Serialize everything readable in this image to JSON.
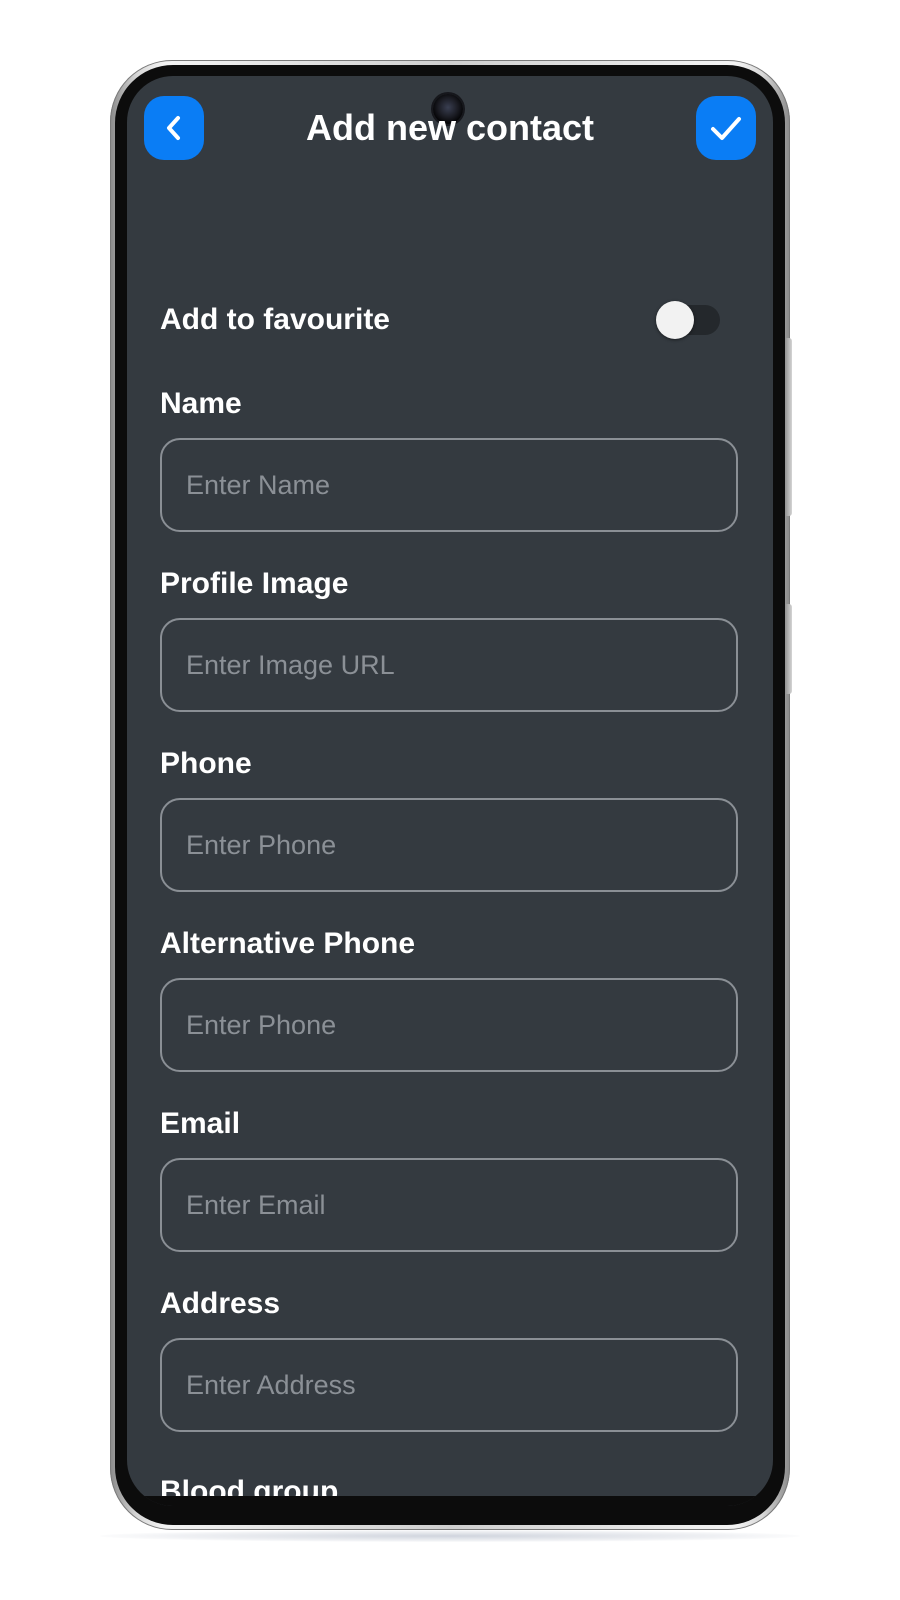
{
  "header": {
    "title": "Add new contact",
    "back_icon": "chevron-left-icon",
    "confirm_icon": "check-icon",
    "button_color": "#0a7df5"
  },
  "favourite": {
    "label": "Add to favourite",
    "enabled": false
  },
  "fields": [
    {
      "label": "Name",
      "placeholder": "Enter Name",
      "value": ""
    },
    {
      "label": "Profile Image",
      "placeholder": "Enter Image URL",
      "value": ""
    },
    {
      "label": "Phone",
      "placeholder": "Enter Phone",
      "value": ""
    },
    {
      "label": "Alternative Phone",
      "placeholder": "Enter Phone",
      "value": ""
    },
    {
      "label": "Email",
      "placeholder": "Enter Email",
      "value": ""
    },
    {
      "label": "Address",
      "placeholder": "Enter Address",
      "value": ""
    },
    {
      "label": "Blood group"
    }
  ],
  "colors": {
    "screen_background": "#343a40",
    "input_border": "#8a8f95",
    "placeholder": "#8b9096"
  }
}
